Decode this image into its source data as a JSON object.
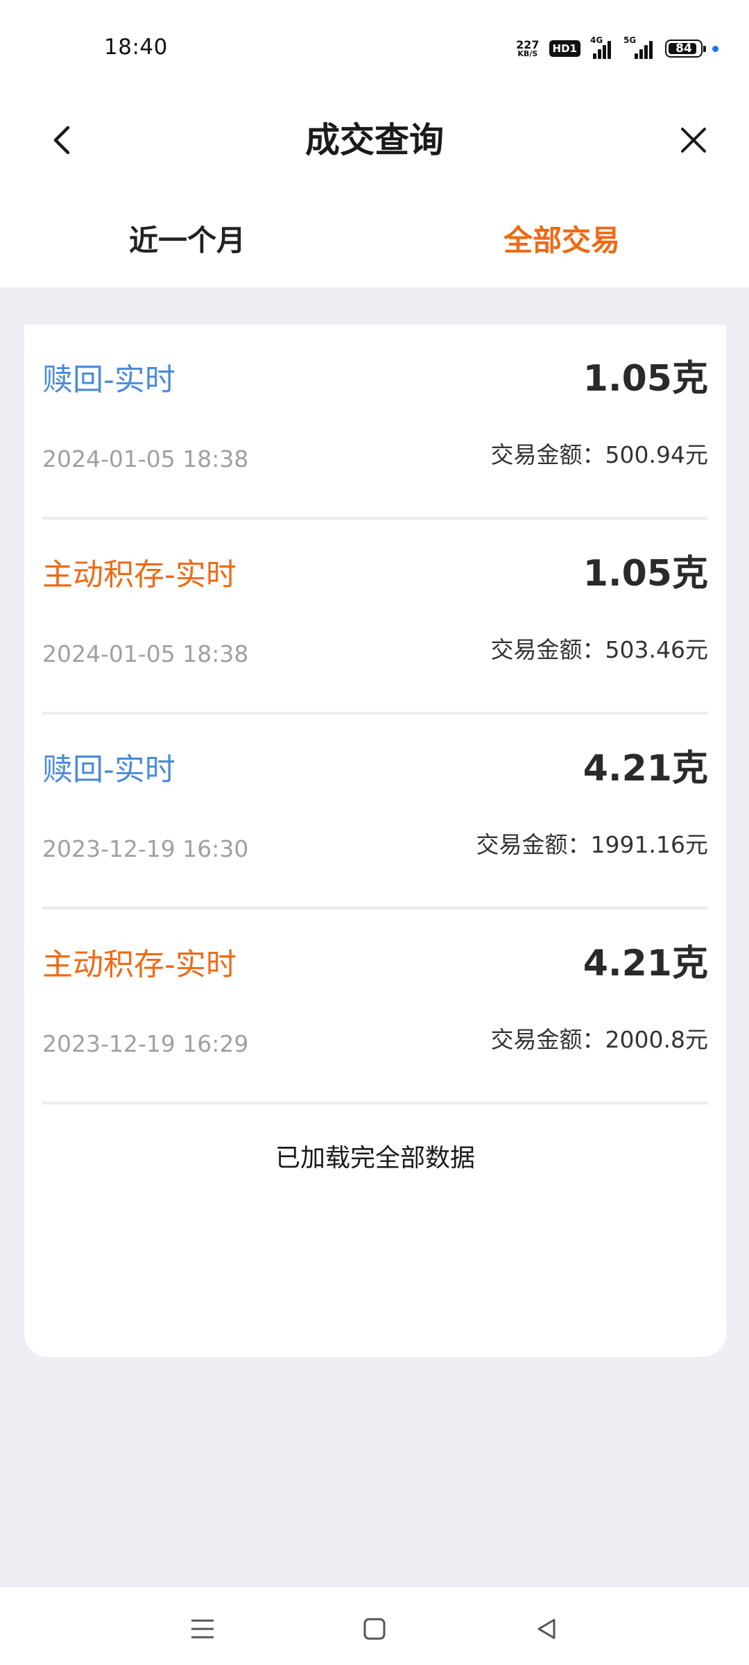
{
  "status_bar": {
    "time": "18:40",
    "net_speed_value": "227",
    "net_speed_unit": "KB/S",
    "hd_label": "HD1",
    "signal1_label": "4G",
    "signal2_label": "5G",
    "battery": "84"
  },
  "header": {
    "title": "成交查询",
    "back_icon": "chevron-left-icon",
    "close_icon": "close-icon"
  },
  "tabs": [
    {
      "label": "近一个月",
      "active": false
    },
    {
      "label": "全部交易",
      "active": true
    }
  ],
  "transactions": [
    {
      "type": "赎回-实时",
      "type_color": "#4a8bd8",
      "weight": "1.05克",
      "date": "2024-01-05 18:38",
      "amount": "交易金额：500.94元"
    },
    {
      "type": "主动积存-实时",
      "type_color": "#ee6a14",
      "weight": "1.05克",
      "date": "2024-01-05 18:38",
      "amount": "交易金额：503.46元"
    },
    {
      "type": "赎回-实时",
      "type_color": "#4a8bd8",
      "weight": "4.21克",
      "date": "2023-12-19 16:30",
      "amount": "交易金额：1991.16元"
    },
    {
      "type": "主动积存-实时",
      "type_color": "#ee6a14",
      "weight": "4.21克",
      "date": "2023-12-19 16:29",
      "amount": "交易金额：2000.8元"
    }
  ],
  "loaded_text": "已加载完全部数据",
  "colors": {
    "accent": "#ee6a14",
    "blue": "#4a8bd8",
    "background": "#eeeff5"
  }
}
